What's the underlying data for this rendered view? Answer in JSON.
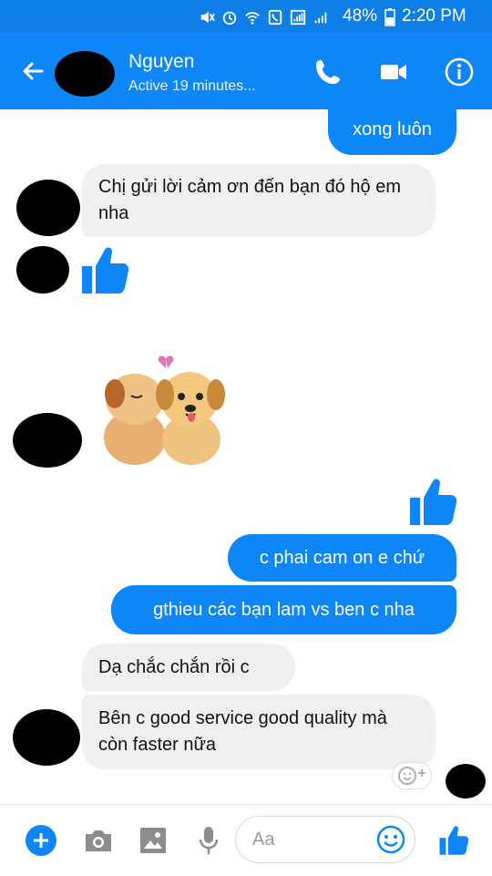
{
  "status_bar": {
    "battery": "48%",
    "time": "2:20 PM"
  },
  "header": {
    "name": "Nguyen",
    "status": "Active 19 minutes..."
  },
  "messages": [
    {
      "sender": "me",
      "text": "xong luôn"
    },
    {
      "sender": "them",
      "text": "Chị gửi lời cảm ơn đến bạn đó hộ em nha"
    },
    {
      "sender": "them",
      "type": "like"
    },
    {
      "sender": "them",
      "type": "sticker",
      "icon": "two-puppies-sticker"
    },
    {
      "sender": "me",
      "type": "like"
    },
    {
      "sender": "me",
      "text": "c phai cam on e chứ"
    },
    {
      "sender": "me",
      "text": "gthieu các bạn lam vs ben c nha"
    },
    {
      "sender": "them",
      "text": "Dạ chắc chắn rồi c"
    },
    {
      "sender": "them",
      "text": "Bên c good service good quality mà còn faster nữa"
    }
  ],
  "composer": {
    "placeholder": "Aa"
  },
  "colors": {
    "brand": "#0f86f7",
    "status_bar": "#0d7fe6",
    "incoming_bubble": "#f1f0f0",
    "outgoing_bubble": "#0f86f7"
  }
}
